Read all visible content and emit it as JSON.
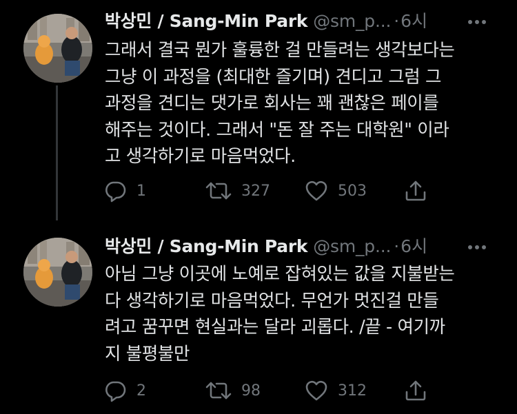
{
  "tweets": [
    {
      "author_name": "박상민 / Sang-Min Park",
      "handle": "@sm_p...",
      "separator": "·",
      "time": "6시",
      "text_lines": [
        "그래서 결국 뭔가 훌륭한 걸 만들려는 생각보다는",
        "그냥 이 과정을 (최대한 즐기며) 견디고 그럼 그",
        "과정을 견디는 댓가로 회사는 꽤 괜찮은 페이를",
        "해주는 것이다. 그래서 \"돈 잘 주는 대학원\" 이라",
        "고 생각하기로 마음먹었다."
      ],
      "replies": "1",
      "retweets": "327",
      "likes": "503"
    },
    {
      "author_name": "박상민 / Sang-Min Park",
      "handle": "@sm_p...",
      "separator": "·",
      "time": "6시",
      "text_lines": [
        "아님 그냥 이곳에 노예로 잡혀있는 값을 지불받는",
        "다 생각하기로 마음먹었다. 무언가 멋진걸 만들",
        "려고 꿈꾸면 현실과는 달라 괴롭다. /끝 - 여기까",
        "지 불평불만"
      ],
      "replies": "2",
      "retweets": "98",
      "likes": "312"
    }
  ],
  "icons": {
    "more": "more-horizontal-icon",
    "reply": "reply-bubble-icon",
    "retweet": "retweet-arrows-icon",
    "like": "heart-icon",
    "share": "share-upload-icon"
  },
  "colors": {
    "background": "#000000",
    "primary_text": "#e7e9ea",
    "secondary_text": "#71767b",
    "thread_line": "#333639"
  }
}
